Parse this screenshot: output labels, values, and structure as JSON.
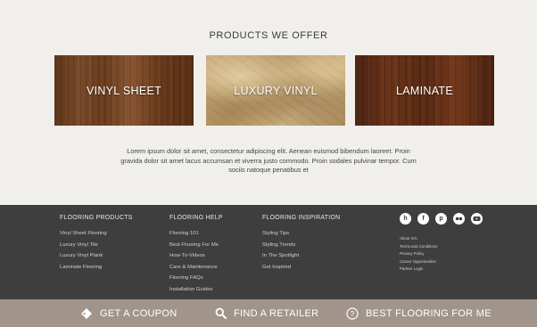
{
  "products": {
    "title": "PRODUCTS WE OFFER",
    "tiles": [
      {
        "label": "VINYL SHEET"
      },
      {
        "label": "LUXURY VINYL"
      },
      {
        "label": "LAMINATE"
      }
    ],
    "description": "Lorem ipsum dolor sit amet, consectetur adipiscing elit. Aenean euismod bibendum laoreet. Proin gravida dolor sit amet lacus accumsan et viverra justo commodo. Proin sodales pulvinar tempor. Cum sociis natoque penatibus et"
  },
  "footer": {
    "columns": [
      {
        "heading": "FLOORING PRODUCTS",
        "links": [
          "Vinyl Sheet Flooring",
          "Luxury Vinyl Tile",
          "Luxury Vinyl Plank",
          "Laminate Flooring"
        ]
      },
      {
        "heading": "FLOORING HELP",
        "links": [
          "Flooring 101",
          "Best Flooring For Me",
          "How-To-Videos",
          "Care & Maintenance",
          "Flooring FAQs",
          "Installation Guides"
        ]
      },
      {
        "heading": "FLOORING INSPIRATION",
        "links": [
          "Styling Tips",
          "Styling Trends",
          "In The Spotlight",
          "Get Inspired"
        ]
      }
    ],
    "social_icons": [
      "houzz-icon",
      "facebook-icon",
      "pinterest-icon",
      "flickr-icon",
      "youtube-icon"
    ],
    "small_links": [
      "About IVC",
      "Terms and Conditions",
      "Privacy Policy",
      "Career Opportunities",
      "Partner Login"
    ]
  },
  "bottom_bar": {
    "coupon": {
      "label": "GET A COUPON",
      "icon": "tag-icon"
    },
    "retailer": {
      "label": "FIND A RETAILER",
      "icon": "search-icon"
    },
    "best_flooring": {
      "label": "BEST FLOORING FOR ME",
      "icon": "question-circle-icon"
    }
  },
  "colors": {
    "page_bg": "#f0efeb",
    "footer_bg": "#3e3e3e",
    "bottom_bar_bg": "#a1958b"
  }
}
